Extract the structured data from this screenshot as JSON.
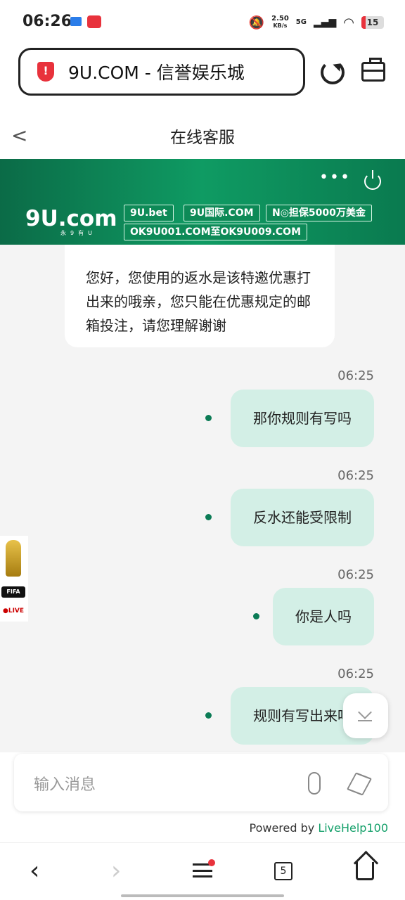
{
  "status_bar": {
    "time": "06:26",
    "net_speed": "2.50\nKB/s",
    "net_speed_top": "2.50",
    "net_speed_unit": "KB/s",
    "network": "5G",
    "battery": "15"
  },
  "browser": {
    "url_title": "9U.COM - 信誉娱乐城"
  },
  "page": {
    "title": "在线客服"
  },
  "banner": {
    "logo": "9U.com",
    "logo_sub": "永9有U",
    "tags": [
      "9U.bet",
      "9U国际.COM",
      "N◎担保5000万美金",
      "OK9U001.COM至OK9U009.COM"
    ]
  },
  "chat": {
    "incoming": "您好，您使用的返水是该特邀优惠打出来的哦亲，您只能在优惠规定的邮箱投注，请您理解谢谢",
    "messages": [
      {
        "time": "06:25",
        "text": "那你规则有写吗"
      },
      {
        "time": "06:25",
        "text": "反水还能受限制"
      },
      {
        "time": "06:25",
        "text": "你是人吗"
      },
      {
        "time": "06:25",
        "text": "规则有写出来吗"
      }
    ]
  },
  "fifa_widget": {
    "badge": "FIFA",
    "live": "●LIVE"
  },
  "composer": {
    "placeholder": "输入消息"
  },
  "footer": {
    "powered_prefix": "Powered by ",
    "powered_brand": "LiveHelp100"
  },
  "nav": {
    "tabs_count": "5"
  }
}
